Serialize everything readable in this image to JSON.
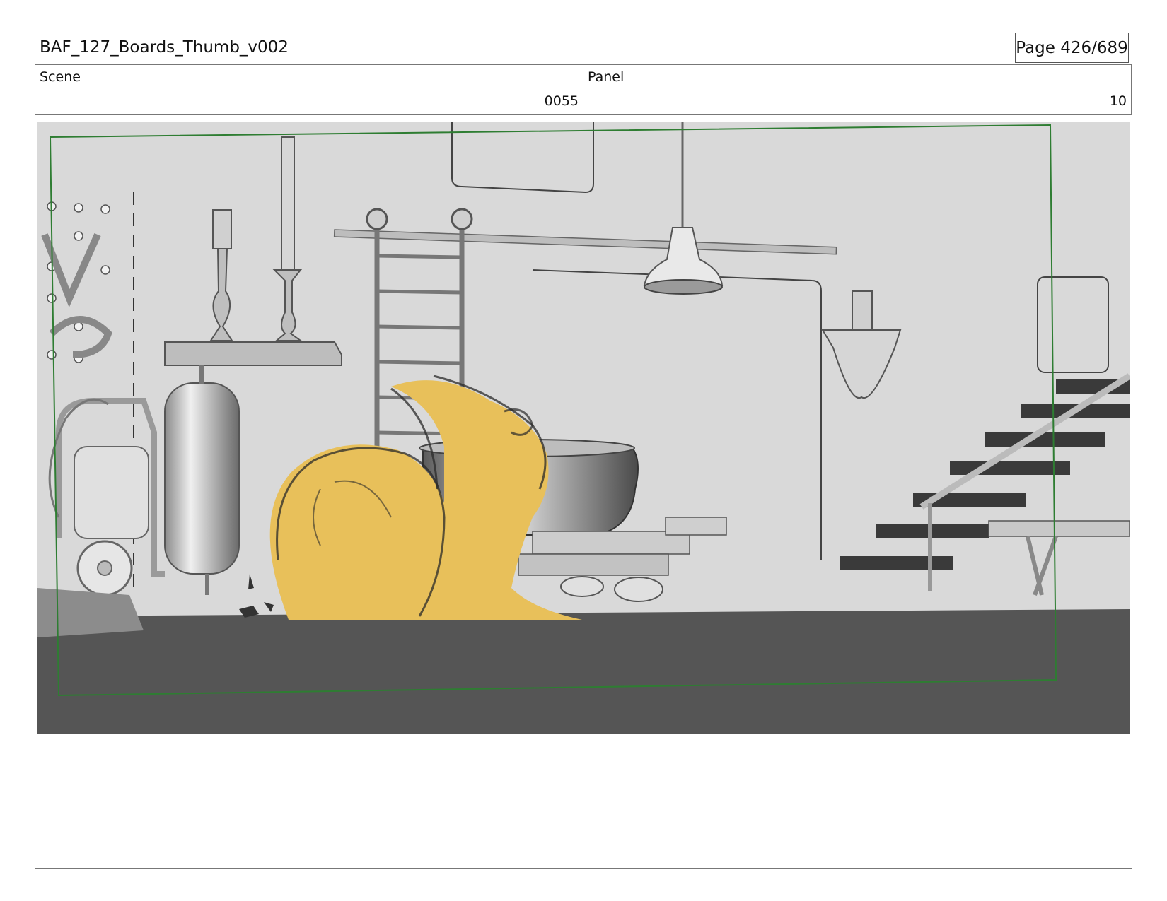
{
  "header": {
    "document_title": "BAF_127_Boards_Thumb_v002",
    "page_label": "Page 426/689"
  },
  "info": {
    "scene_label": "Scene",
    "scene_value": "0055",
    "panel_label": "Panel",
    "panel_value": "10"
  },
  "panel_image": {
    "description_icon": "storyboard-panel-image",
    "colors": {
      "wall": "#d9d9d9",
      "floor": "#555555",
      "character": "#e8c05a",
      "safe_frame": "#2e7d32"
    }
  },
  "notes": {
    "text": ""
  }
}
